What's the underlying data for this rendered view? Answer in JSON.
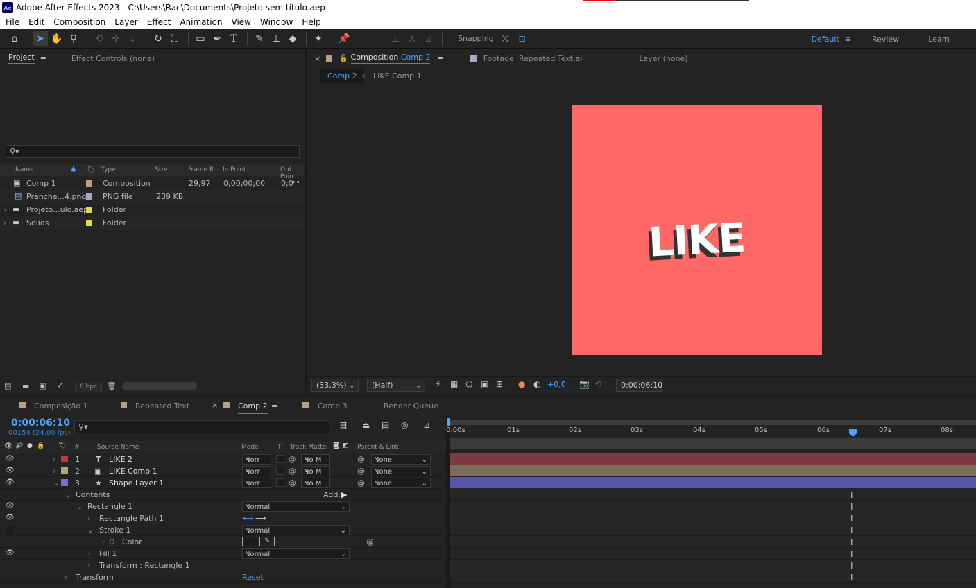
{
  "titlebar": {
    "app_icon": "Ae",
    "title": "Adobe After Effects 2023 - C:\\Users\\Rac\\Documents\\Projeto sem título.aep"
  },
  "menu": [
    "File",
    "Edit",
    "Composition",
    "Layer",
    "Effect",
    "Animation",
    "View",
    "Window",
    "Help"
  ],
  "toolbar": {
    "snapping_label": "Snapping"
  },
  "workspaces": {
    "default": "Default",
    "review": "Review",
    "learn": "Learn"
  },
  "project_panel": {
    "tab_project": "Project",
    "tab_effect_controls": "Effect Controls (none)",
    "columns": {
      "name": "Name",
      "type": "Type",
      "size": "Size",
      "frame_rate": "Frame R...",
      "in_point": "In Point",
      "out_point": "Out Poin"
    },
    "items": [
      {
        "name": "Comp 1",
        "type": "Composition",
        "size": "",
        "frame_rate": "29,97",
        "in_point": "0;00;00;00",
        "out_point": "0;0",
        "color": "#b5a27a"
      },
      {
        "name": "Pranche...4.png",
        "type": "PNG file",
        "size": "239 KB",
        "frame_rate": "",
        "in_point": "",
        "out_point": "",
        "color": "#a7a7c8"
      },
      {
        "name": "Projeto...ulo.aep",
        "type": "Folder",
        "size": "",
        "frame_rate": "",
        "in_point": "",
        "out_point": "",
        "color": "#e6d74e"
      },
      {
        "name": "Solids",
        "type": "Folder",
        "size": "",
        "frame_rate": "",
        "in_point": "",
        "out_point": "",
        "color": "#e6d74e"
      }
    ],
    "bpc": "8 bpc"
  },
  "viewer": {
    "tab_composition": "Composition",
    "tab_composition_name": "Comp 2",
    "tab_footage": "Footage",
    "tab_footage_name": "Repeated Text.ai",
    "tab_layer": "Layer (none)",
    "breadcrumb_current": "Comp 2",
    "breadcrumb_parent": "LIKE Comp 1",
    "comp_text": "LIKE",
    "comp_bg": "#fe6968",
    "zoom": "(33,3%)",
    "resolution": "(Half)",
    "exposure": "+0,0",
    "timecode": "0:00:06:10"
  },
  "timeline": {
    "tabs": [
      "Composição 1",
      "Repeated Text",
      "Comp 2",
      "Comp 3",
      "Render Queue"
    ],
    "tab_colors": [
      "#b5a27a",
      "#b5a27a",
      "",
      "#b5a27a",
      ""
    ],
    "timecode": "0:00:06:10",
    "frame_info": "00154 (24.00 fps)",
    "columns": {
      "num": "#",
      "source_name": "Source Name",
      "mode": "Mode",
      "t": "T",
      "track_matte": "Track Matte",
      "parent": "Parent & Link"
    },
    "layers": [
      {
        "num": "1",
        "type_icon": "T",
        "name": "LIKE 2",
        "mode": "Norr",
        "matte": "No M",
        "parent": "None",
        "color": "#c13a3a",
        "bar": "#7e3b3e"
      },
      {
        "num": "2",
        "type_icon": "comp",
        "name": "LIKE Comp 1",
        "mode": "Norr",
        "matte": "No M",
        "parent": "None",
        "color": "#b5a27a",
        "bar": "#7a6e5a"
      },
      {
        "num": "3",
        "type_icon": "star",
        "name": "Shape Layer 1",
        "mode": "Norr",
        "matte": "No M",
        "parent": "None",
        "color": "#6f6fd8",
        "bar": "#5656a6"
      }
    ],
    "props": {
      "contents": "Contents",
      "add": "Add:",
      "rectangle1": "Rectangle 1",
      "rectangle1_mode": "Normal",
      "rect_path": "Rectangle Path 1",
      "stroke1": "Stroke 1",
      "stroke1_mode": "Normal",
      "color": "Color",
      "fill1": "Fill 1",
      "fill1_mode": "Normal",
      "transform_rect": "Transform : Rectangle 1",
      "transform": "Transform",
      "reset": "Reset"
    },
    "ruler": [
      "0:00s",
      "01s",
      "02s",
      "03s",
      "04s",
      "05s",
      "06s",
      "07s",
      "08s"
    ],
    "current_time_fraction": 0.765
  }
}
